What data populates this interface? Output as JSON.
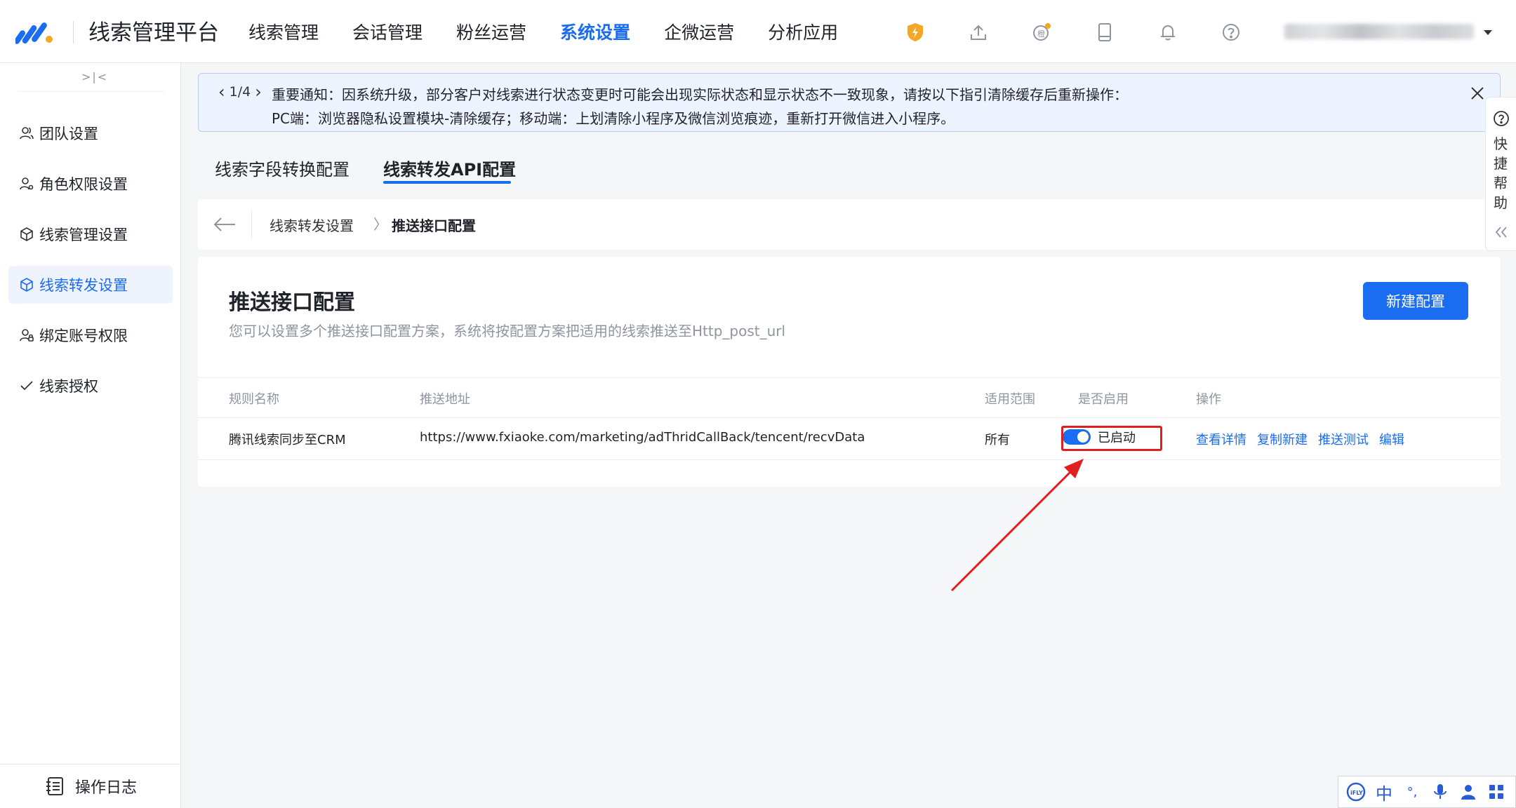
{
  "header": {
    "app_title": "线索管理平台",
    "nav": [
      "线索管理",
      "会话管理",
      "粉丝运营",
      "系统设置",
      "企微运营",
      "分析应用"
    ],
    "active_nav": "系统设置",
    "icons": [
      "lightning-shield-icon",
      "upload-icon",
      "badge-icon",
      "tablet-icon",
      "bell-icon",
      "help-icon"
    ],
    "user_name_blurred": true
  },
  "sidebar": {
    "collapse_label": ">|<",
    "items": [
      {
        "label": "团队设置",
        "icon": "team-icon"
      },
      {
        "label": "角色权限设置",
        "icon": "role-icon"
      },
      {
        "label": "线索管理设置",
        "icon": "cube-icon"
      },
      {
        "label": "线索转发设置",
        "icon": "cube-forward-icon"
      },
      {
        "label": "绑定账号权限",
        "icon": "user-lock-icon"
      },
      {
        "label": "线索授权",
        "icon": "check-icon"
      }
    ],
    "active_item": "线索转发设置",
    "footer_label": "操作日志"
  },
  "notice": {
    "pager": "1/4",
    "line1": "重要通知：因系统升级，部分客户对线索进行状态变更时可能会出现实际状态和显示状态不一致现象，请按以下指引清除缓存后重新操作：",
    "line2": "PC端：浏览器隐私设置模块-清除缓存；移动端：上划清除小程序及微信浏览痕迹，重新打开微信进入小程序。"
  },
  "tabs": [
    "线索字段转换配置",
    "线索转发API配置"
  ],
  "active_tab": "线索转发API配置",
  "breadcrumb": {
    "parent": "线索转发设置",
    "separator": "〉",
    "current": "推送接口配置"
  },
  "card": {
    "title": "推送接口配置",
    "description": "您可以设置多个推送接口配置方案，系统将按配置方案把适用的线索推送至Http_post_url",
    "new_button": "新建配置"
  },
  "table": {
    "columns": [
      "规则名称",
      "推送地址",
      "适用范围",
      "是否启用",
      "操作"
    ],
    "rows": [
      {
        "name": "腾讯线索同步至CRM",
        "url": "https://www.fxiaoke.com/marketing/adThridCallBack/tencent/recvData",
        "scope": "所有",
        "enabled": true,
        "enabled_label": "已启动",
        "actions": [
          "查看详情",
          "复制新建",
          "推送测试",
          "编辑"
        ]
      }
    ]
  },
  "help_float": {
    "label": "快捷帮助"
  },
  "ime": {
    "brand": "iFLY",
    "mode": "中",
    "punct": "°,"
  },
  "colors": {
    "accent": "#1a6cf0",
    "highlight": "#e02020",
    "notice_bg": "#eef4ff"
  }
}
